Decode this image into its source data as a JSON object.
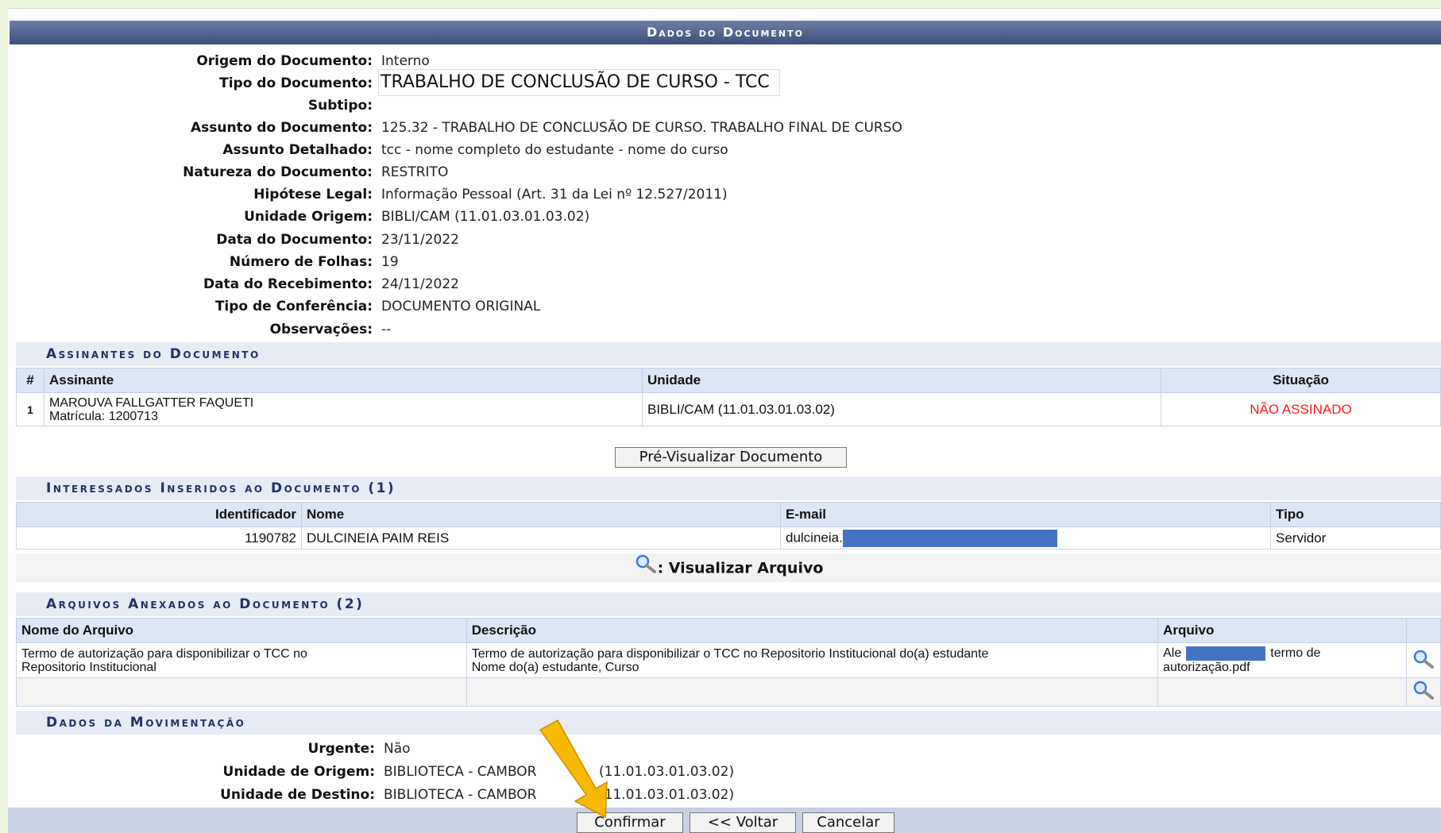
{
  "main_caption": "Dados do Documento",
  "fields": [
    {
      "label": "Origem do Documento:",
      "value": "Interno"
    },
    {
      "label": "Tipo do Documento:",
      "value": "TRABALHO DE CONCLUSÃO DE CURSO - TCC"
    },
    {
      "label": "Subtipo:",
      "value": ""
    },
    {
      "label": "Assunto do Documento:",
      "value": "125.32 - TRABALHO DE CONCLUSÃO DE CURSO. TRABALHO FINAL DE CURSO"
    },
    {
      "label": "Assunto Detalhado:",
      "value": "tcc - nome completo do estudante - nome do curso"
    },
    {
      "label": "Natureza do Documento:",
      "value": "RESTRITO"
    },
    {
      "label": "Hipótese Legal:",
      "value": "Informação Pessoal (Art. 31 da Lei nº 12.527/2011)"
    },
    {
      "label": "Unidade Origem:",
      "value": "BIBLI/CAM (11.01.03.01.03.02)"
    },
    {
      "label": "Data do Documento:",
      "value": "23/11/2022"
    },
    {
      "label": "Número de Folhas:",
      "value": "19"
    },
    {
      "label": "Data do Recebimento:",
      "value": "24/11/2022"
    },
    {
      "label": "Tipo de Conferência:",
      "value": "DOCUMENTO ORIGINAL"
    },
    {
      "label": "Observações:",
      "value": "--"
    }
  ],
  "assinantes": {
    "caption": "Assinantes do Documento",
    "headers": [
      "#",
      "Assinante",
      "Unidade",
      "Situação"
    ],
    "rows": [
      {
        "num": "1",
        "name": "MAROUVA FALLGATTER FAQUETI",
        "matricula": "Matrícula: 1200713",
        "unidade": "BIBLI/CAM (11.01.03.01.03.02)",
        "situacao": "NÃO ASSINADO"
      }
    ],
    "status_color": "#ff1a1a"
  },
  "preview_button": "Pré-Visualizar Documento",
  "interessados": {
    "caption": "Interessados Inseridos ao Documento (1)",
    "headers": [
      "Identificador",
      "Nome",
      "E-mail",
      "Tipo"
    ],
    "rows": [
      {
        "id": "1190782",
        "nome": "DULCINEIA PAIM REIS",
        "email": "dulcineia.",
        "tipo": "Servidor"
      }
    ]
  },
  "legend": {
    "icon": "magnifier-icon",
    "text": ": Visualizar Arquivo"
  },
  "arquivos": {
    "caption": "Arquivos Anexados ao Documento (2)",
    "headers": [
      "Nome do Arquivo",
      "Descrição",
      "Arquivo"
    ],
    "rows": [
      {
        "nome_l1": "Termo de autorização para disponibilizar o TCC no",
        "nome_l2": "Repositorio Institucional",
        "desc_l1": "Termo de autorização para disponibilizar o TCC no Repositorio Institucional do(a) estudante",
        "desc_l2": "Nome do(a) estudante, Curso",
        "arq_l1a": "Ale",
        "arq_l1b": "termo de",
        "arq_l2": "autorização.pdf"
      },
      {
        "nome_l1": "",
        "nome_l2": "",
        "desc_l1": "",
        "desc_l2": "",
        "arq_l1a": "",
        "arq_l1b": "",
        "arq_l2": ""
      }
    ]
  },
  "movimentacao": {
    "caption": "Dados da Movimentação",
    "fields": [
      {
        "label": "Urgente:",
        "value": "Não"
      },
      {
        "label": "Unidade de Origem:",
        "value": "BIBLIOTECA - CAMBOR",
        "code": "(11.01.03.01.03.02)"
      },
      {
        "label": "Unidade de Destino:",
        "value": "BIBLIOTECA - CAMBOR",
        "code": "(11.01.03.01.03.02)"
      }
    ]
  },
  "buttons": {
    "confirm": "Confirmar",
    "back": "<< Voltar",
    "cancel": "Cancelar"
  },
  "colors": {
    "caption_bg": "#3d4e79",
    "redaction": "#4472c4",
    "arrow": "#f6b800",
    "page_bg": "#eaf4dd"
  }
}
